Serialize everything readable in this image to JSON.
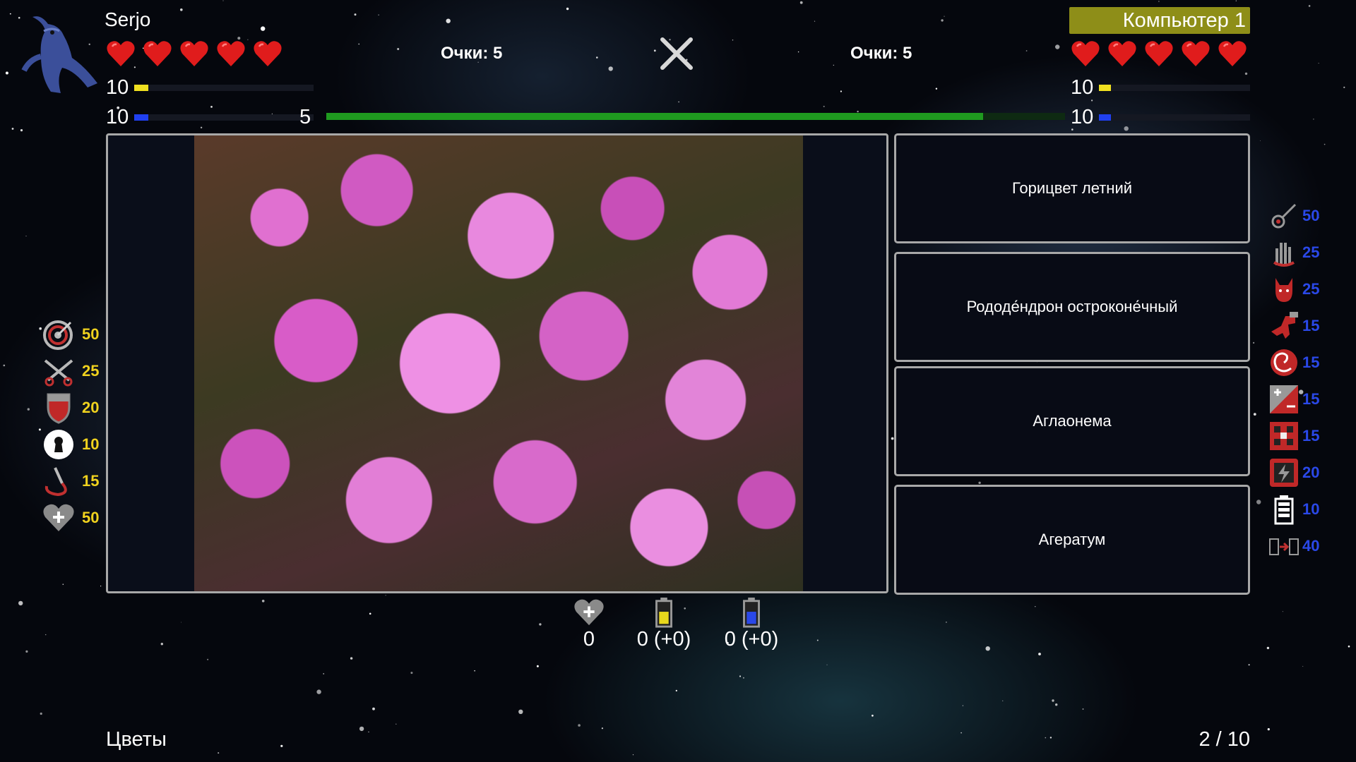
{
  "player": {
    "name": "Serjo",
    "hearts": 5,
    "stat1": {
      "value": "10",
      "color": "#f0e020",
      "fill": 0.08
    },
    "stat2": {
      "value": "10",
      "color": "#2040f0",
      "fill": 0.08
    },
    "score_label": "Очки: 5"
  },
  "opponent": {
    "name": "Компьютер 1",
    "hearts": 5,
    "stat1": {
      "value": "10",
      "color": "#f0e020",
      "fill": 0.08
    },
    "stat2": {
      "value": "10",
      "color": "#2040f0",
      "fill": 0.08
    },
    "score_label": "Очки: 5"
  },
  "timer": {
    "value": "5",
    "fill": 0.889,
    "color": "#1f9a1f"
  },
  "close_icon": "close-icon",
  "answers": [
    "Горицвет летний",
    "Рододе́ндрон остроконе́чный",
    "Аглаонема",
    "Агератум"
  ],
  "player_skills": [
    {
      "icon": "target-icon",
      "value": "50"
    },
    {
      "icon": "crossed-arrows-icon",
      "value": "25"
    },
    {
      "icon": "shield-icon",
      "value": "20"
    },
    {
      "icon": "keyhole-icon",
      "value": "10"
    },
    {
      "icon": "whip-icon",
      "value": "15"
    },
    {
      "icon": "heart-plus-icon",
      "value": "50"
    }
  ],
  "opponent_skills": [
    {
      "icon": "comet-icon",
      "value": "50"
    },
    {
      "icon": "hand-icon",
      "value": "25"
    },
    {
      "icon": "devil-icon",
      "value": "25"
    },
    {
      "icon": "dinosaur-icon",
      "value": "15"
    },
    {
      "icon": "spiral-icon",
      "value": "15"
    },
    {
      "icon": "plus-minus-icon",
      "value": "15"
    },
    {
      "icon": "checker-icon",
      "value": "15"
    },
    {
      "icon": "lightning-icon",
      "value": "20"
    },
    {
      "icon": "battery-icon",
      "value": "10"
    },
    {
      "icon": "battery-transfer-icon",
      "value": "40"
    }
  ],
  "bottom": {
    "heart": {
      "icon": "heart-plus-icon",
      "value": "0"
    },
    "yellow_battery": {
      "icon": "yellow-battery-icon",
      "value": "0 (+0)"
    },
    "blue_battery": {
      "icon": "blue-battery-icon",
      "value": "0 (+0)"
    }
  },
  "footer": {
    "category": "Цветы",
    "progress": "2 / 10"
  }
}
